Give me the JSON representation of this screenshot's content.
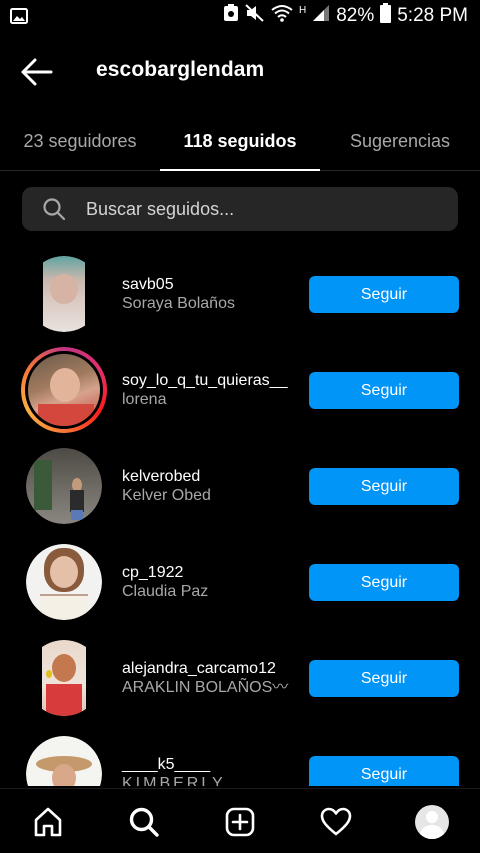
{
  "status_bar": {
    "battery_percent": "82%",
    "time": "5:28 PM",
    "network_type": "H"
  },
  "header": {
    "title": "escobarglendam"
  },
  "tabs": [
    {
      "label": "23 seguidores",
      "active": false
    },
    {
      "label": "118 seguidos",
      "active": true
    },
    {
      "label": "Sugerencias",
      "active": false
    }
  ],
  "search": {
    "placeholder": "Buscar seguidos..."
  },
  "users": [
    {
      "username": "savb05",
      "full_name": "Soraya Bolaños",
      "button_label": "Seguir",
      "story_ring": false
    },
    {
      "username": "soy_lo_q_tu_quieras__",
      "full_name": "lorena",
      "button_label": "Seguir",
      "story_ring": true
    },
    {
      "username": "kelverobed",
      "full_name": "Kelver Obed",
      "button_label": "Seguir",
      "story_ring": false
    },
    {
      "username": "cp_1922",
      "full_name": "Claudia Paz",
      "button_label": "Seguir",
      "story_ring": false
    },
    {
      "username": "alejandra_carcamo12",
      "full_name": "ARAKLIN BOLAÑOS〰",
      "button_label": "Seguir",
      "story_ring": false
    },
    {
      "username": "____k5____",
      "full_name": "KIMBERLY",
      "button_label": "Seguir",
      "story_ring": false
    }
  ],
  "bottom_nav": {
    "items": [
      "home-icon",
      "search-icon",
      "create-icon",
      "activity-heart-icon",
      "profile-avatar"
    ]
  },
  "colors": {
    "background": "#000000",
    "button_blue": "#0095f6",
    "search_bg": "#262626",
    "secondary_text": "#a8a8a8"
  }
}
